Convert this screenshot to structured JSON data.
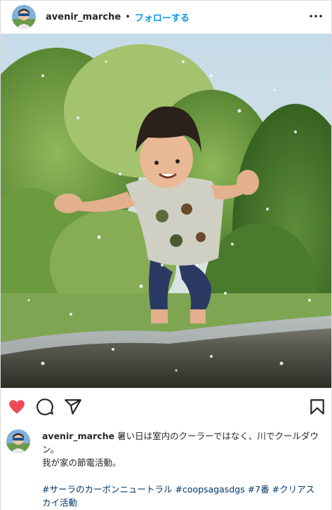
{
  "header": {
    "username": "avenir_marche",
    "separator": "•",
    "follow_label": "フォローする",
    "more_icon": "more-horizontal-icon"
  },
  "photo": {
    "subject": "photo"
  },
  "actions": {
    "liked": true,
    "like_color": "#ed4956",
    "icons": [
      "heart-icon",
      "comment-icon",
      "share-icon",
      "bookmark-icon"
    ]
  },
  "caption": {
    "username": "avenir_marche",
    "line1": "暑い日は室内のクーラーではなく、川でクールダウン。",
    "line2": "我が家の節電活動。",
    "hashtags": [
      "#サーラのカーボンニュートラル",
      "#coopsagasdgs",
      "#7番",
      "#クリアスカイ活動"
    ]
  },
  "colors": {
    "link": "#0095f6",
    "hashtag": "#00376b",
    "text": "#262626"
  }
}
